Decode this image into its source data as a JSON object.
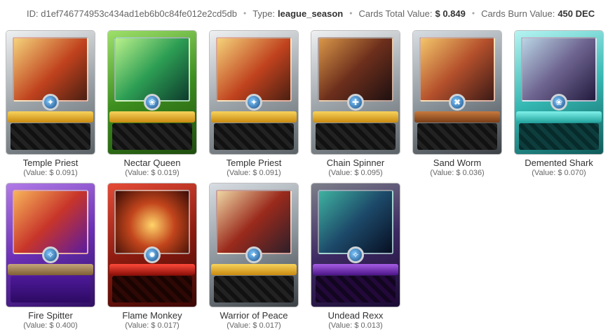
{
  "header": {
    "id_label": "ID:",
    "id_value": "d1ef746774953c434ad1eb6b0c84fe012e2cd5db",
    "type_label": "Type:",
    "type_value": "league_season",
    "total_label": "Cards Total Value:",
    "total_value": "$ 0.849",
    "burn_label": "Cards Burn Value:",
    "burn_value": "450 DEC"
  },
  "cards": [
    {
      "name": "Temple Priest",
      "value": "(Value: $ 0.091)",
      "frame_color": "#9ea5aa",
      "art_colors": [
        "#f0c070",
        "#c0421e"
      ],
      "icon": "water-gem"
    },
    {
      "name": "Nectar Queen",
      "value": "(Value: $ 0.019)",
      "frame_color": "#3d8e1e",
      "art_colors": [
        "#8fd86a",
        "#0f5d44"
      ],
      "icon": "earth-gem"
    },
    {
      "name": "Temple Priest",
      "value": "(Value: $ 0.091)",
      "frame_color": "#9ea5aa",
      "art_colors": [
        "#f0c070",
        "#c0421e"
      ],
      "icon": "water-gem"
    },
    {
      "name": "Chain Spinner",
      "value": "(Value: $ 0.095)",
      "frame_color": "#9ea5aa",
      "art_colors": [
        "#c07a3a",
        "#3a1d18"
      ],
      "icon": "life-gem"
    },
    {
      "name": "Sand Worm",
      "value": "(Value: $ 0.036)",
      "frame_color": "#5b6368",
      "art_colors": [
        "#e9b45a",
        "#7a2f1f"
      ],
      "icon": "fire-gem"
    },
    {
      "name": "Demented Shark",
      "value": "(Value: $ 0.070)",
      "frame_color": "#35b8b3",
      "art_colors": [
        "#8fb1c8",
        "#3a2b5f"
      ],
      "icon": "earth-gem"
    },
    {
      "name": "Fire Spitter",
      "value": "(Value: $ 0.400)",
      "frame_color": "#6a2fb5",
      "art_colors": [
        "#f09a3c",
        "#b5261f"
      ],
      "icon": "death-gem"
    },
    {
      "name": "Flame Monkey",
      "value": "(Value: $ 0.017)",
      "frame_color": "#8d1b10",
      "art_colors": [
        "#ffcc55",
        "#5a1a0f"
      ],
      "icon": "fire-gem"
    },
    {
      "name": "Warrior of Peace",
      "value": "(Value: $ 0.017)",
      "frame_color": "#8d969d",
      "art_colors": [
        "#e8c48a",
        "#a52018"
      ],
      "icon": "neutral-gem"
    },
    {
      "name": "Undead Rexx",
      "value": "(Value: $ 0.013)",
      "frame_color": "#6a2fb5",
      "art_colors": [
        "#2a8a80",
        "#0b1f3a"
      ],
      "icon": "death-gem"
    }
  ]
}
